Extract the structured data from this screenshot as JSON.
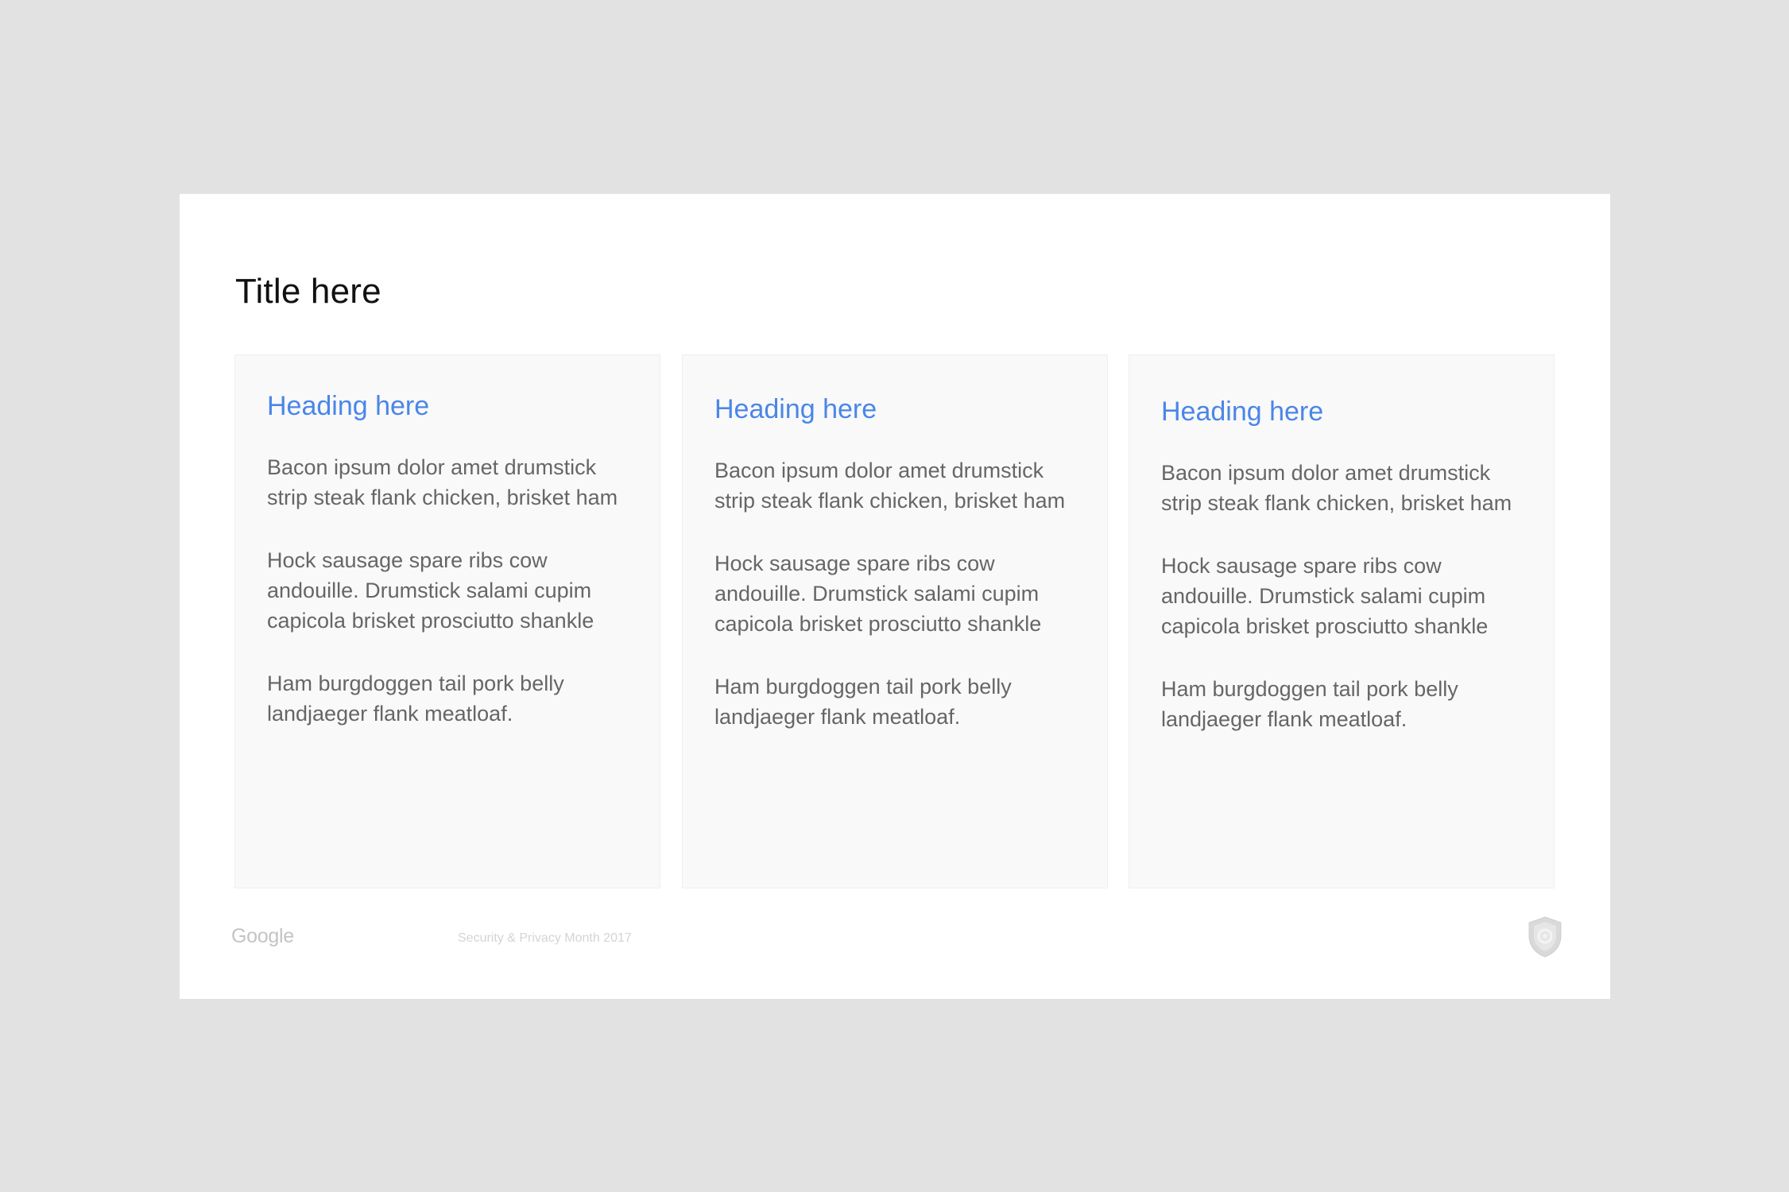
{
  "slide": {
    "title": "Title here",
    "cards": [
      {
        "heading": "Heading here",
        "paragraphs": [
          "Bacon ipsum dolor amet drumstick strip steak flank chicken, brisket ham",
          "Hock sausage spare ribs cow andouille. Drumstick salami cupim capicola brisket prosciutto shankle",
          "Ham burgdoggen tail pork belly landjaeger flank meatloaf."
        ]
      },
      {
        "heading": "Heading here",
        "paragraphs": [
          "Bacon ipsum dolor amet drumstick strip steak flank chicken, brisket ham",
          "Hock sausage spare ribs cow andouille. Drumstick salami cupim capicola brisket prosciutto shankle",
          "Ham burgdoggen tail pork belly landjaeger flank meatloaf."
        ]
      },
      {
        "heading": "Heading here",
        "paragraphs": [
          "Bacon ipsum dolor amet drumstick strip steak flank chicken, brisket ham",
          "Hock sausage spare ribs cow andouille. Drumstick salami cupim capicola brisket prosciutto shankle",
          "Ham burgdoggen tail pork belly landjaeger flank meatloaf."
        ]
      }
    ],
    "footer": {
      "logo": "Google",
      "text": "Security & Privacy Month 2017",
      "badge_icon": "shield-icon"
    }
  },
  "colors": {
    "background": "#e2e2e2",
    "slide": "#ffffff",
    "card": "#f9f9f9",
    "heading_accent": "#4a86e8",
    "body_text": "#666666",
    "footer_text": "#d4d4d4"
  }
}
